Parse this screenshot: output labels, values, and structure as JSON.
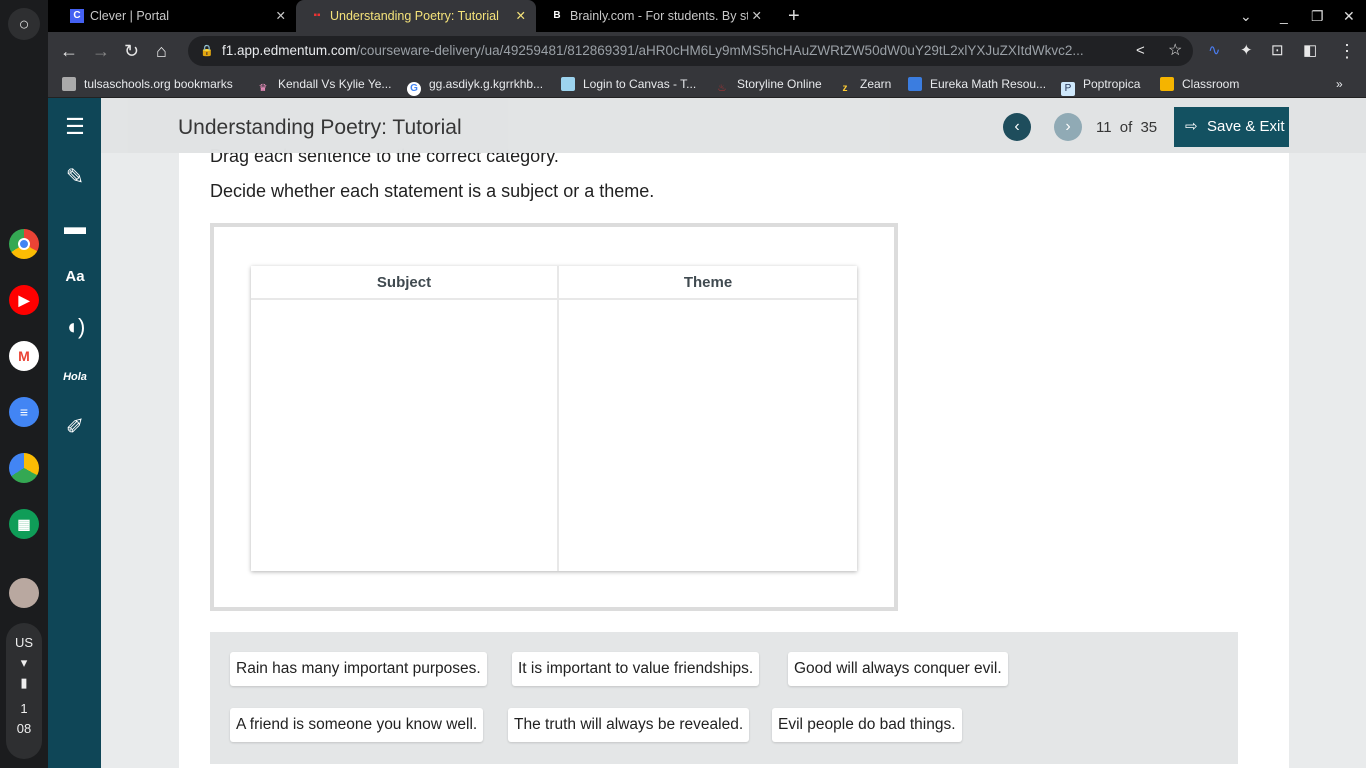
{
  "browser": {
    "tabs": [
      {
        "label": "Clever | Portal"
      },
      {
        "label": "Understanding Poetry: Tutorial"
      },
      {
        "label": "Brainly.com - For students. By st"
      }
    ],
    "url_host": "f1.app.edmentum.com",
    "url_path": "/courseware-delivery/ua/49259481/812869391/aHR0cHM6Ly9mMS5hcHAuZWRtZW50dW0uY29tL2xlYXJuZXItdWkvc2...",
    "bookmarks": [
      "tulsaschools.org bookmarks",
      "Kendall Vs Kylie Ye...",
      "gg.asdiyk.g.kgrrkhb...",
      "Login to Canvas - T...",
      "Storyline Online",
      "Zearn",
      "Eureka Math Resou...",
      "Poptropica",
      "Classroom"
    ]
  },
  "shelf": {
    "locale": "US",
    "time_h": "1",
    "time_m": "08"
  },
  "header": {
    "title": "Understanding Poetry: Tutorial",
    "current": "11",
    "of": "of",
    "total": "35",
    "save_label": "Save & Exit"
  },
  "question": {
    "instruction1": "Drag each sentence to the correct category.",
    "instruction2": "Decide whether each statement is a subject or a theme.",
    "categories": [
      "Subject",
      "Theme"
    ],
    "chips": [
      "Rain has many important purposes.",
      "It is important to value friendships.",
      "Good will always conquer evil.",
      "A friend is someone you know well.",
      "The truth will always be revealed.",
      "Evil people do bad things."
    ]
  },
  "colors": {
    "sidebar": "#0f4657",
    "save": "#0f4e5f",
    "active_tab_text": "#f4e27a"
  }
}
